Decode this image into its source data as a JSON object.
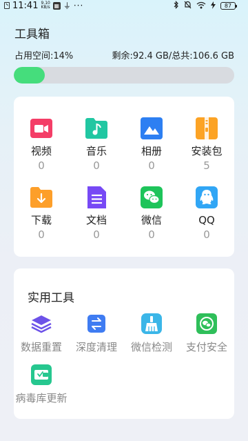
{
  "status_bar": {
    "time": "11:41",
    "speed_value": "9.10",
    "speed_unit": "KB/s",
    "battery": "87",
    "icons": [
      "sim-icon",
      "hd-badge-icon",
      "usb-icon",
      "more-dots-icon",
      "bluetooth-icon",
      "mute-icon",
      "wifi-icon",
      "charging-icon",
      "battery-icon"
    ]
  },
  "header": {
    "title": "工具箱",
    "usage_left": "占用空间:14%",
    "usage_right": "剩余:92.4 GB/总共:106.6 GB",
    "usage_fraction": 0.14,
    "fill_color": "#45dd7c"
  },
  "categories": [
    {
      "label": "视频",
      "count": "0",
      "icon": "video-icon",
      "color": "#f43e67"
    },
    {
      "label": "音乐",
      "count": "0",
      "icon": "music-icon",
      "color": "#21c7a2"
    },
    {
      "label": "相册",
      "count": "0",
      "icon": "photo-icon",
      "color": "#2d7ff2"
    },
    {
      "label": "安装包",
      "count": "5",
      "icon": "package-icon",
      "color": "#fca325"
    },
    {
      "label": "下载",
      "count": "0",
      "icon": "download-icon",
      "color": "#fd9f2a"
    },
    {
      "label": "文档",
      "count": "0",
      "icon": "document-icon",
      "color": "#7749f5"
    },
    {
      "label": "微信",
      "count": "0",
      "icon": "wechat-icon",
      "color": "#1ec45a"
    },
    {
      "label": "QQ",
      "count": "0",
      "icon": "qq-icon",
      "color": "#31a6f5"
    }
  ],
  "tools": {
    "title": "实用工具",
    "items": [
      {
        "label": "数据重置",
        "icon": "layers-icon",
        "color": "#6d52e8"
      },
      {
        "label": "深度清理",
        "icon": "swap-icon",
        "color": "#3f7cf2"
      },
      {
        "label": "微信检测",
        "icon": "broom-icon",
        "color": "#3bb6e8"
      },
      {
        "label": "支付安全",
        "icon": "pay-shield-icon",
        "color": "#2fbf5a"
      },
      {
        "label": "病毒库更新",
        "icon": "virus-update-icon",
        "color": "#26c78f"
      }
    ]
  }
}
